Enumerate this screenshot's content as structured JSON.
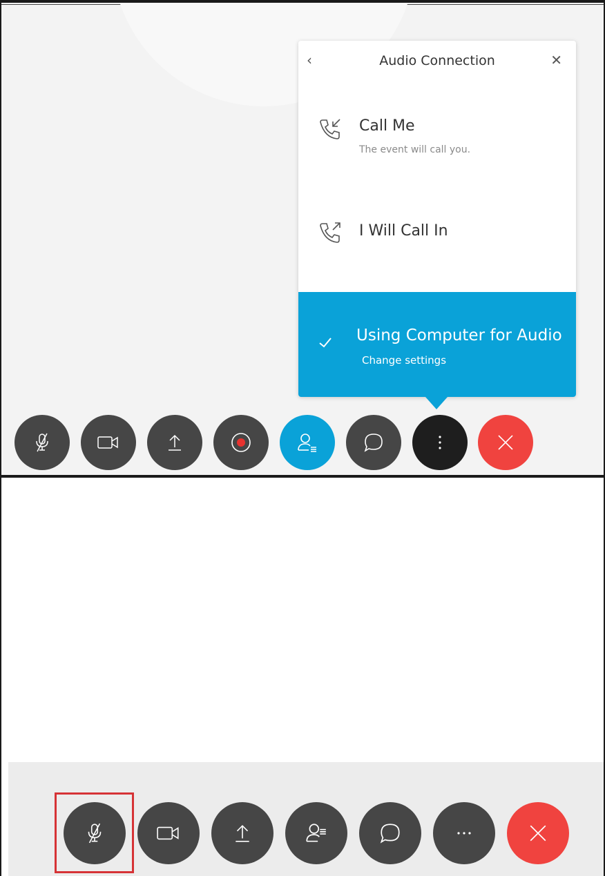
{
  "popover": {
    "title": "Audio Connection",
    "back_icon": "chevron-left-icon",
    "close_icon": "close-icon",
    "options": [
      {
        "title": "Call Me",
        "subtitle": "The event will call you.",
        "icon": "phone-incoming-icon"
      },
      {
        "title": "I Will Call In",
        "icon": "phone-outgoing-icon"
      }
    ],
    "selected": {
      "title": "Using Computer for Audio",
      "subtitle": "Change settings",
      "icon": "check-icon",
      "bg": "#0aa2d8"
    }
  },
  "toolbar_top": {
    "buttons": [
      {
        "icon": "mic-muted-icon",
        "color": "#464646"
      },
      {
        "icon": "video-camera-icon",
        "color": "#464646"
      },
      {
        "icon": "share-upload-icon",
        "color": "#464646"
      },
      {
        "icon": "record-icon",
        "color": "#464646"
      },
      {
        "icon": "participants-icon",
        "color": "#0aa2d8"
      },
      {
        "icon": "chat-icon",
        "color": "#464646"
      },
      {
        "icon": "more-vertical-icon",
        "color": "#1e1e1e"
      },
      {
        "icon": "leave-icon",
        "color": "#f0433f"
      }
    ]
  },
  "toolbar_bottom": {
    "buttons": [
      {
        "icon": "mic-muted-icon",
        "color": "#464646",
        "highlighted": true
      },
      {
        "icon": "video-camera-icon",
        "color": "#464646"
      },
      {
        "icon": "share-upload-icon",
        "color": "#464646"
      },
      {
        "icon": "participants-icon",
        "color": "#464646"
      },
      {
        "icon": "chat-icon",
        "color": "#464646"
      },
      {
        "icon": "more-horizontal-icon",
        "color": "#464646"
      },
      {
        "icon": "leave-icon",
        "color": "#f0433f"
      }
    ],
    "highlight_color": "#d63336"
  }
}
